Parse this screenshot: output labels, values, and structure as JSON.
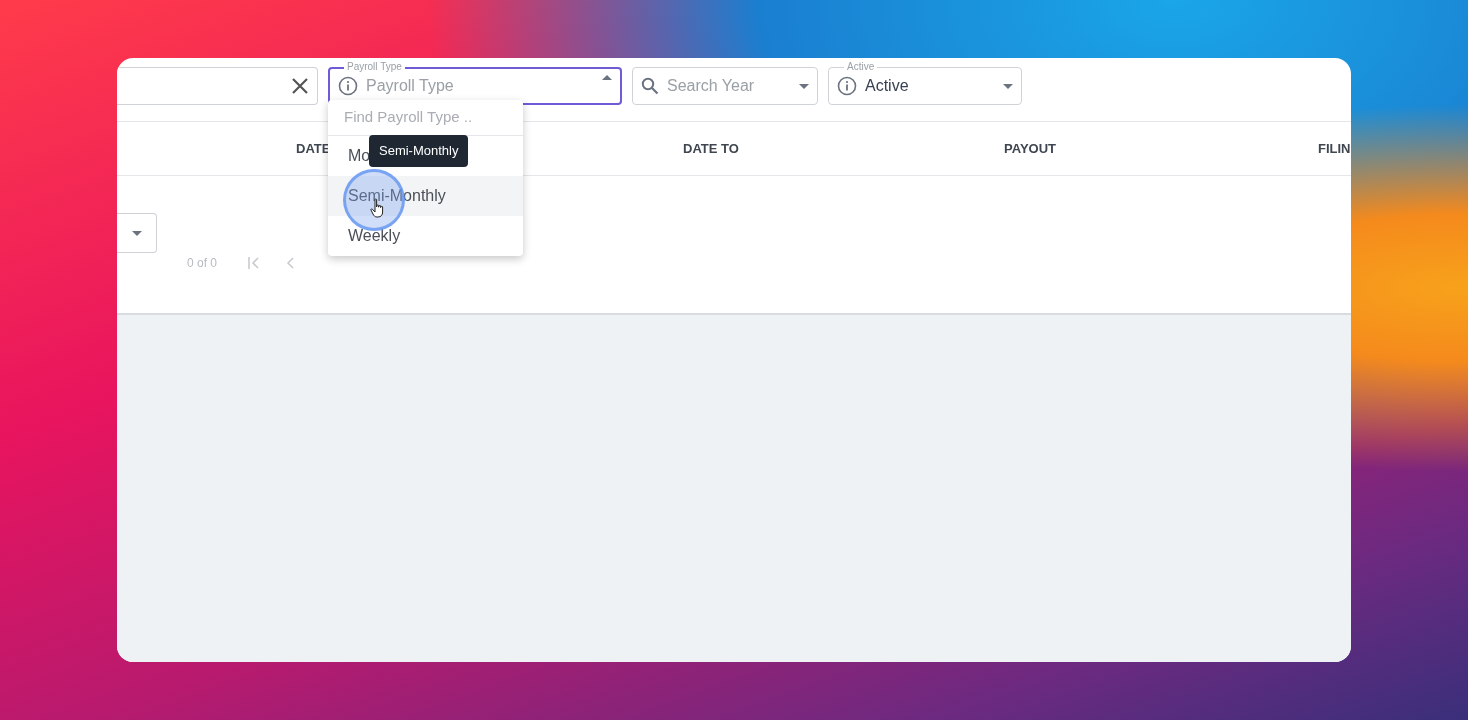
{
  "filters": [
    {
      "kind": "clearable"
    },
    {
      "kind": "info-select",
      "label": "Payroll Type",
      "placeholder": "Payroll Type",
      "open": true
    },
    {
      "kind": "search-select",
      "placeholder": "Search Year",
      "open": false
    },
    {
      "kind": "info-select",
      "label": "Active",
      "value": "Active",
      "open": false
    }
  ],
  "dropdown": {
    "search_placeholder": "Find Payroll Type ..",
    "tooltip": "Semi-Monthly",
    "items": [
      {
        "label": "Mo",
        "selected": false
      },
      {
        "label": "Semi-Monthly",
        "selected": true
      },
      {
        "label": "Weekly",
        "selected": false
      }
    ]
  },
  "table": {
    "columns": [
      "DATE",
      "DATE TO",
      "PAYOUT",
      "FILIN"
    ]
  },
  "pagination": {
    "range": "0 of 0"
  }
}
